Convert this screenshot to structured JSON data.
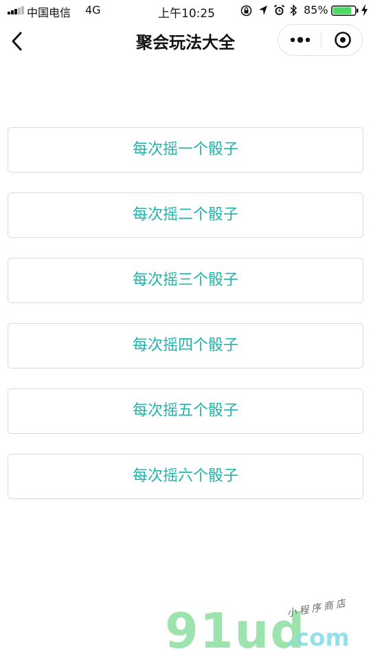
{
  "status_bar": {
    "carrier": "中国电信",
    "network": "4G",
    "time": "上午10:25",
    "battery_percent": "85%",
    "battery_level": 0.85,
    "icons": [
      "signal-icon",
      "rotation-lock-icon",
      "location-icon",
      "alarm-icon",
      "bluetooth-icon",
      "battery-icon",
      "charging-icon"
    ]
  },
  "nav": {
    "title": "聚会玩法大全",
    "back_icon": "chevron-left-icon",
    "menu_icon": "more-dots-icon",
    "close_icon": "target-circle-icon"
  },
  "options": [
    {
      "label": "每次摇一个骰子"
    },
    {
      "label": "每次摇二个骰子"
    },
    {
      "label": "每次摇三个骰子"
    },
    {
      "label": "每次摇四个骰子"
    },
    {
      "label": "每次摇五个骰子"
    },
    {
      "label": "每次摇六个骰子"
    }
  ],
  "watermark": {
    "logo": "91ud",
    "domain": ".com",
    "tagline": "小程序商店"
  },
  "colors": {
    "accent": "#1fb4ab",
    "border": "#d9d9d9",
    "battery_fill": "#4cd964",
    "text": "#111111"
  }
}
